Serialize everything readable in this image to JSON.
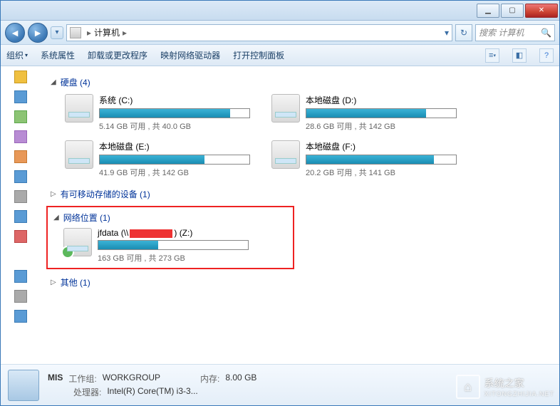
{
  "toolbar": {
    "organize": "组织",
    "sysprops": "系统属性",
    "uninstall": "卸载或更改程序",
    "mapdrive": "映射网络驱动器",
    "controlpanel": "打开控制面板"
  },
  "address": {
    "root": "计算机",
    "sep": "▸"
  },
  "search": {
    "placeholder": "搜索 计算机"
  },
  "sections": {
    "hdd": {
      "label": "硬盘 (4)",
      "expanded": true
    },
    "removable": {
      "label": "有可移动存储的设备 (1)",
      "expanded": false
    },
    "network": {
      "label": "网络位置 (1)",
      "expanded": true
    },
    "other": {
      "label": "其他 (1)",
      "expanded": false
    }
  },
  "drives": [
    {
      "name": "系统 (C:)",
      "free": "5.14 GB 可用 , 共 40.0 GB",
      "fill": 87
    },
    {
      "name": "本地磁盘 (D:)",
      "free": "28.6 GB 可用 , 共 142 GB",
      "fill": 80
    },
    {
      "name": "本地磁盘 (E:)",
      "free": "41.9 GB 可用 , 共 142 GB",
      "fill": 70
    },
    {
      "name": "本地磁盘 (F:)",
      "free": "20.2 GB 可用 , 共 141 GB",
      "fill": 85
    }
  ],
  "netdrive": {
    "prefix": "jfdata (\\\\",
    "suffix": ") (Z:)",
    "free": "163 GB 可用 , 共 273 GB",
    "fill": 40
  },
  "status": {
    "name": "MIS",
    "wg_label": "工作组:",
    "wg_value": "WORKGROUP",
    "mem_label": "内存:",
    "mem_value": "8.00 GB",
    "cpu_label": "处理器:",
    "cpu_value": "Intel(R) Core(TM) i3-3..."
  },
  "watermark": {
    "title": "系统之家",
    "sub": "XITONGZHIJIA.NET"
  }
}
